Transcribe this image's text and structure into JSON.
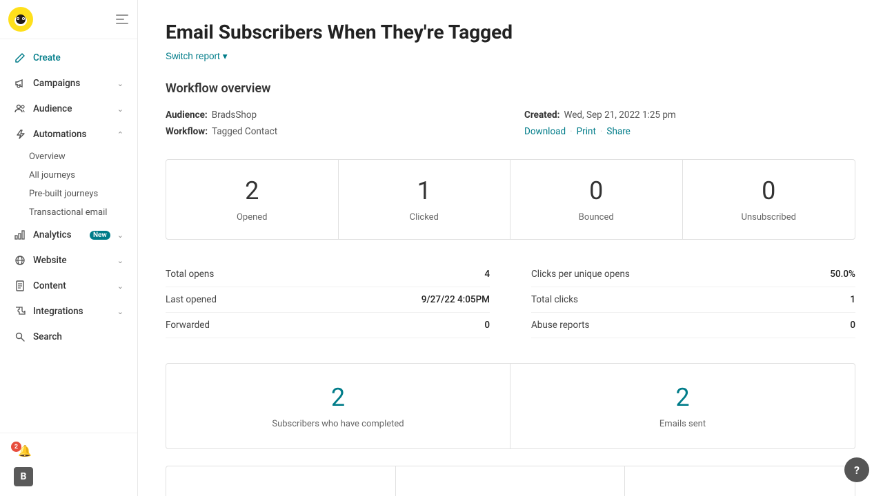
{
  "sidebar": {
    "nav_items": [
      {
        "id": "create",
        "label": "Create",
        "icon": "pencil",
        "active": true,
        "badge": null,
        "expandable": false
      },
      {
        "id": "campaigns",
        "label": "Campaigns",
        "icon": "megaphone",
        "badge": null,
        "expandable": true
      },
      {
        "id": "audience",
        "label": "Audience",
        "icon": "people",
        "badge": null,
        "expandable": true
      },
      {
        "id": "automations",
        "label": "Automations",
        "icon": "bolt",
        "badge": null,
        "expandable": true
      },
      {
        "id": "analytics",
        "label": "Analytics",
        "icon": "chart",
        "badge": "New",
        "expandable": true
      },
      {
        "id": "website",
        "label": "Website",
        "icon": "globe",
        "badge": null,
        "expandable": true
      },
      {
        "id": "content",
        "label": "Content",
        "icon": "document",
        "badge": null,
        "expandable": true
      },
      {
        "id": "integrations",
        "label": "Integrations",
        "icon": "puzzle",
        "badge": null,
        "expandable": true
      },
      {
        "id": "search",
        "label": "Search",
        "icon": "search",
        "badge": null,
        "expandable": false
      }
    ],
    "automations_subnav": [
      "Overview",
      "All journeys",
      "Pre-built journeys",
      "Transactional email"
    ],
    "notification_count": "2",
    "avatar_letter": "B"
  },
  "header": {
    "title": "Email Subscribers When They're Tagged",
    "switch_report_label": "Switch report",
    "switch_report_chevron": "▾"
  },
  "workflow_overview": {
    "section_title": "Workflow overview",
    "audience_label": "Audience:",
    "audience_value": "BradsShop",
    "workflow_label": "Workflow:",
    "workflow_value": "Tagged Contact",
    "created_label": "Created:",
    "created_value": "Wed, Sep 21, 2022 1:25 pm",
    "download_label": "Download",
    "print_label": "Print",
    "share_label": "Share"
  },
  "stats": {
    "cards": [
      {
        "number": "2",
        "label": "Opened"
      },
      {
        "number": "1",
        "label": "Clicked"
      },
      {
        "number": "0",
        "label": "Bounced"
      },
      {
        "number": "0",
        "label": "Unsubscribed"
      }
    ],
    "details_left": [
      {
        "label": "Total opens",
        "value": "4"
      },
      {
        "label": "Last opened",
        "value": "9/27/22 4:05PM"
      },
      {
        "label": "Forwarded",
        "value": "0"
      }
    ],
    "details_right": [
      {
        "label": "Clicks per unique opens",
        "value": "50.0%"
      },
      {
        "label": "Total clicks",
        "value": "1"
      },
      {
        "label": "Abuse reports",
        "value": "0"
      }
    ]
  },
  "bottom_stats": {
    "cards": [
      {
        "number": "2",
        "label": "Subscribers who have completed"
      },
      {
        "number": "2",
        "label": "Emails sent"
      }
    ]
  },
  "help": {
    "icon": "?"
  }
}
